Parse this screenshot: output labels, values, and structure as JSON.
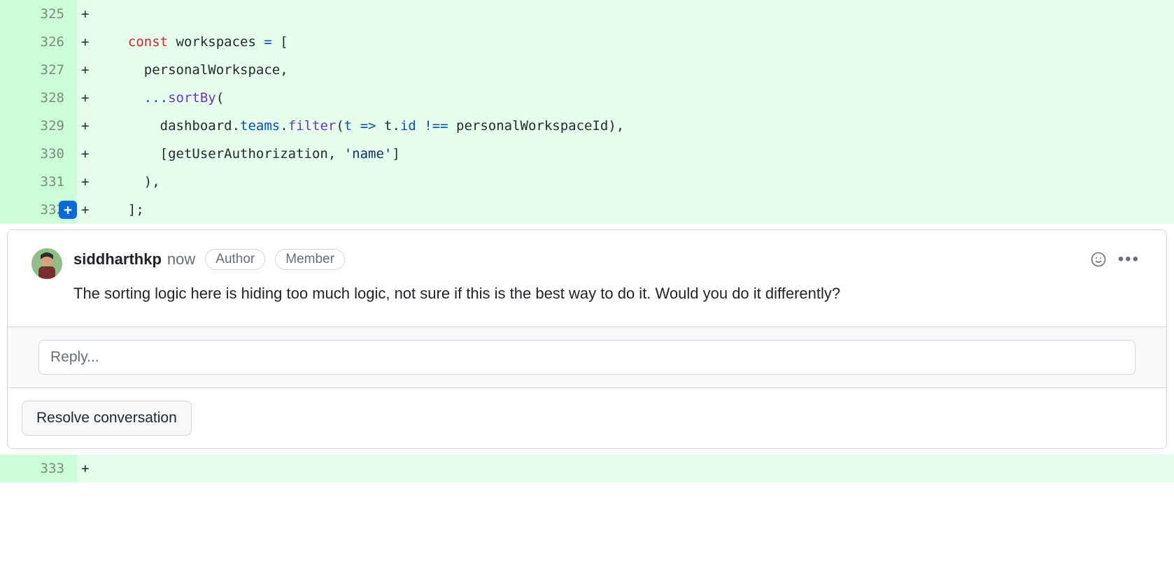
{
  "diff": {
    "marker": "+",
    "lines": [
      {
        "num": 325,
        "tokens": []
      },
      {
        "num": 326,
        "tokens": [
          {
            "t": "  ",
            "c": ""
          },
          {
            "t": "const",
            "c": "tok-kw"
          },
          {
            "t": " workspaces ",
            "c": "tok-id"
          },
          {
            "t": "=",
            "c": "tok-op"
          },
          {
            "t": " [",
            "c": "tok-id"
          }
        ]
      },
      {
        "num": 327,
        "tokens": [
          {
            "t": "    personalWorkspace,",
            "c": "tok-id"
          }
        ]
      },
      {
        "num": 328,
        "tokens": [
          {
            "t": "    ",
            "c": ""
          },
          {
            "t": "...",
            "c": "tok-op"
          },
          {
            "t": "sortBy",
            "c": "tok-fn"
          },
          {
            "t": "(",
            "c": "tok-id"
          }
        ]
      },
      {
        "num": 329,
        "tokens": [
          {
            "t": "      dashboard.",
            "c": "tok-id"
          },
          {
            "t": "teams",
            "c": "tok-prop"
          },
          {
            "t": ".",
            "c": "tok-id"
          },
          {
            "t": "filter",
            "c": "tok-fn"
          },
          {
            "t": "(",
            "c": "tok-id"
          },
          {
            "t": "t",
            "c": "tok-prop"
          },
          {
            "t": " ",
            "c": ""
          },
          {
            "t": "=>",
            "c": "tok-op"
          },
          {
            "t": " t.",
            "c": "tok-id"
          },
          {
            "t": "id",
            "c": "tok-prop"
          },
          {
            "t": " ",
            "c": ""
          },
          {
            "t": "!==",
            "c": "tok-op"
          },
          {
            "t": " personalWorkspaceId),",
            "c": "tok-id"
          }
        ]
      },
      {
        "num": 330,
        "tokens": [
          {
            "t": "      [getUserAuthorization, ",
            "c": "tok-id"
          },
          {
            "t": "'name'",
            "c": "tok-str"
          },
          {
            "t": "]",
            "c": "tok-id"
          }
        ]
      },
      {
        "num": 331,
        "tokens": [
          {
            "t": "    ),",
            "c": "tok-id"
          }
        ]
      },
      {
        "num": 332,
        "has_add_button": true,
        "tokens": [
          {
            "t": "  ];",
            "c": "tok-id"
          }
        ]
      }
    ],
    "trailing_line": {
      "num": 333
    }
  },
  "comment": {
    "author": "siddharthkp",
    "timestamp": "now",
    "badges": [
      "Author",
      "Member"
    ],
    "text": "The sorting logic here is hiding too much logic, not sure if this is the best way to do it. Would you do it differently?",
    "reply_placeholder": "Reply...",
    "resolve_label": "Resolve conversation",
    "add_comment_glyph": "+",
    "kebab_glyph": "•••"
  }
}
